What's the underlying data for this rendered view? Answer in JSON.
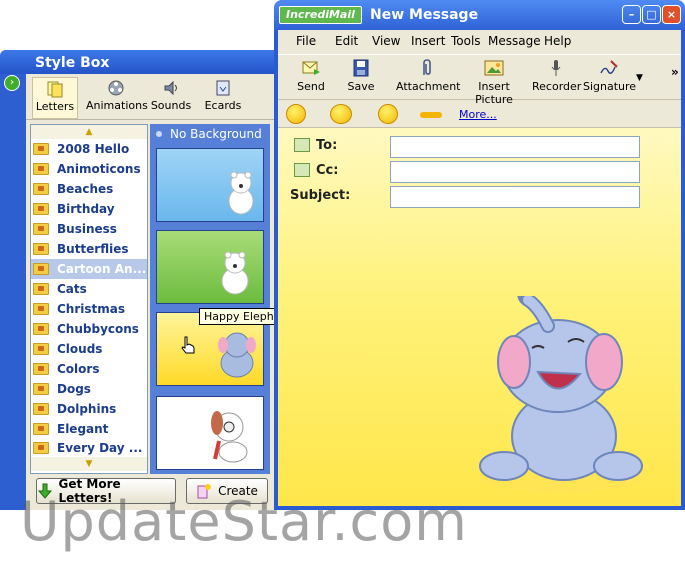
{
  "stylebox": {
    "title": "Style Box",
    "tabs": [
      {
        "label": "Letters",
        "icon": "letters-icon"
      },
      {
        "label": "Animations",
        "icon": "film-reel-icon"
      },
      {
        "label": "Sounds",
        "icon": "speaker-icon"
      },
      {
        "label": "Ecards",
        "icon": "ecard-icon"
      }
    ],
    "categories": [
      "2008 Hello",
      "Animoticons",
      "Beaches",
      "Birthday",
      "Business",
      "Butterflies",
      "Cartoon An...",
      "Cats",
      "Christmas",
      "Chubbycons",
      "Clouds",
      "Colors",
      "Dogs",
      "Dolphins",
      "Elegant",
      "Every Day ..."
    ],
    "selected_category": "Cartoon An...",
    "no_background": "No Background",
    "tooltip": "Happy Elephant",
    "get_more_button": "Get More Letters!",
    "create_button": "Create"
  },
  "message": {
    "brand": "IncrediMail",
    "title": "New Message",
    "menu": [
      "File",
      "Edit",
      "View",
      "Insert",
      "Tools",
      "Message",
      "Help"
    ],
    "toolbar": [
      {
        "label": "Send",
        "icon": "send-icon"
      },
      {
        "label": "Save",
        "icon": "save-icon"
      },
      {
        "label": "Attachment",
        "icon": "paperclip-icon"
      },
      {
        "label": "Insert Picture",
        "icon": "picture-icon"
      },
      {
        "label": "Recorder",
        "icon": "microphone-icon"
      },
      {
        "label": "Signature",
        "icon": "signature-icon"
      }
    ],
    "more_link": "More...",
    "fields": {
      "to_label": "To:",
      "cc_label": "Cc:",
      "subject_label": "Subject:",
      "to_value": "",
      "cc_value": "",
      "subject_value": ""
    }
  },
  "watermark": "UpdateStar.com",
  "colors": {
    "title_blue": "#2f62d6",
    "selected_row": "#b8c8e8",
    "compose_yellow": "#fff27a",
    "link": "#0000cc"
  }
}
